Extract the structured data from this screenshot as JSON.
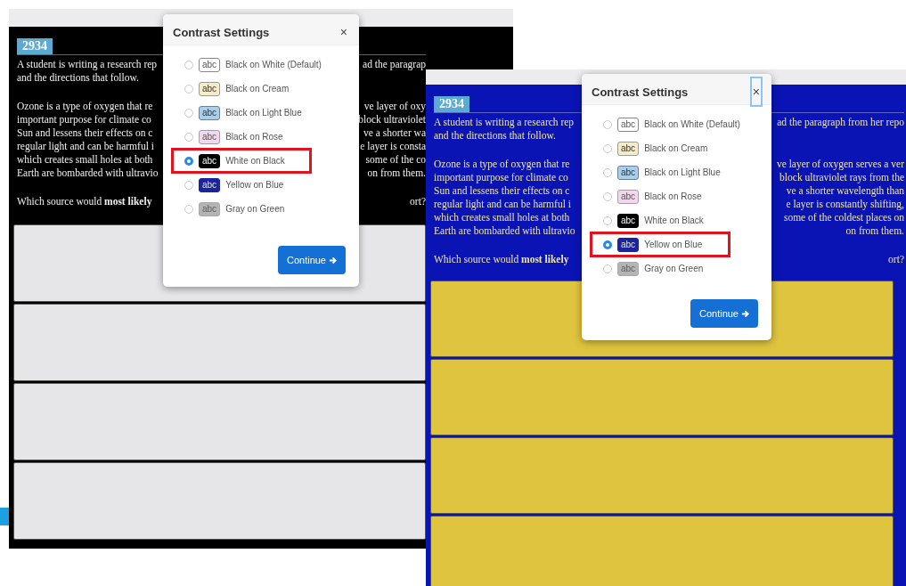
{
  "screens": [
    {
      "kind": "white-on-black",
      "item_number": "2934",
      "paragraphs": [
        [
          {
            "left": "A student is writing a research rep",
            "right": "ad the paragrap"
          },
          {
            "left": "and the directions that follow."
          }
        ],
        [
          {
            "left": "Ozone is a type of oxygen that re",
            "right": "ve layer of oxy"
          },
          {
            "left": "important purpose for climate co",
            "right": "block ultraviolet"
          },
          {
            "left": "Sun and lessens their effects on c",
            "right": "ve a shorter wa"
          },
          {
            "left": "regular light and can be harmful i",
            "right": "e layer is consta"
          },
          {
            "left": "which creates small holes at both",
            "right": "some of the co"
          },
          {
            "left": "Earth are bombarded with ultravio",
            "right": "on from them."
          }
        ],
        [
          {
            "left": "Which source would **most likely**",
            "right": "ort?"
          }
        ]
      ],
      "dialog": {
        "title": "Contrast Settings",
        "close": "×",
        "close_focused": false,
        "button": "Continue",
        "options": [
          {
            "kind": "black-on-white",
            "swatch": "abc",
            "label": "Black on White (Default)",
            "selected": false,
            "highlighted": false
          },
          {
            "kind": "black-on-cream",
            "swatch": "abc",
            "label": "Black on Cream",
            "selected": false,
            "highlighted": false
          },
          {
            "kind": "black-on-light-blue",
            "swatch": "abc",
            "label": "Black on Light Blue",
            "selected": false,
            "highlighted": false
          },
          {
            "kind": "black-on-rose",
            "swatch": "abc",
            "label": "Black on Rose",
            "selected": false,
            "highlighted": false
          },
          {
            "kind": "white-on-black",
            "swatch": "abc",
            "label": "White on Black",
            "selected": true,
            "highlighted": true
          },
          {
            "kind": "yellow-on-blue",
            "swatch": "abc",
            "label": "Yellow on Blue",
            "selected": false,
            "highlighted": false
          },
          {
            "kind": "gray-on-green",
            "swatch": "abc",
            "label": "Gray on Green",
            "selected": false,
            "highlighted": false
          }
        ]
      }
    },
    {
      "kind": "yellow-on-blue",
      "item_number": "2934",
      "paragraphs": [
        [
          {
            "left": "A student is writing a research rep",
            "right": "ad the paragraph from her repo"
          },
          {
            "left": "and the directions that follow."
          }
        ],
        [
          {
            "left": "Ozone is a type of oxygen that re",
            "right": "ve layer of oxygen serves a ver"
          },
          {
            "left": "important purpose for climate co",
            "right": "block ultraviolet rays from the"
          },
          {
            "left": "Sun and lessens their effects on c",
            "right": "ve a shorter wavelength than"
          },
          {
            "left": "regular light and can be harmful i",
            "right": "e layer is constantly shifting,"
          },
          {
            "left": "which creates small holes at both",
            "right": "some of the coldest places on"
          },
          {
            "left": "Earth are bombarded with ultravio",
            "right": "on from them."
          }
        ],
        [
          {
            "left": "Which source would **most likely**",
            "right": "ort?"
          }
        ]
      ],
      "dialog": {
        "title": "Contrast Settings",
        "close": "×",
        "close_focused": true,
        "button": "Continue",
        "options": [
          {
            "kind": "black-on-white",
            "swatch": "abc",
            "label": "Black on White (Default)",
            "selected": false,
            "highlighted": false
          },
          {
            "kind": "black-on-cream",
            "swatch": "abc",
            "label": "Black on Cream",
            "selected": false,
            "highlighted": false
          },
          {
            "kind": "black-on-light-blue",
            "swatch": "abc",
            "label": "Black on Light Blue",
            "selected": false,
            "highlighted": false
          },
          {
            "kind": "black-on-rose",
            "swatch": "abc",
            "label": "Black on Rose",
            "selected": false,
            "highlighted": false
          },
          {
            "kind": "white-on-black",
            "swatch": "abc",
            "label": "White on Black",
            "selected": false,
            "highlighted": false
          },
          {
            "kind": "yellow-on-blue",
            "swatch": "abc",
            "label": "Yellow on Blue",
            "selected": true,
            "highlighted": true
          },
          {
            "kind": "gray-on-green",
            "swatch": "abc",
            "label": "Gray on Green",
            "selected": false,
            "highlighted": false
          }
        ]
      }
    }
  ]
}
